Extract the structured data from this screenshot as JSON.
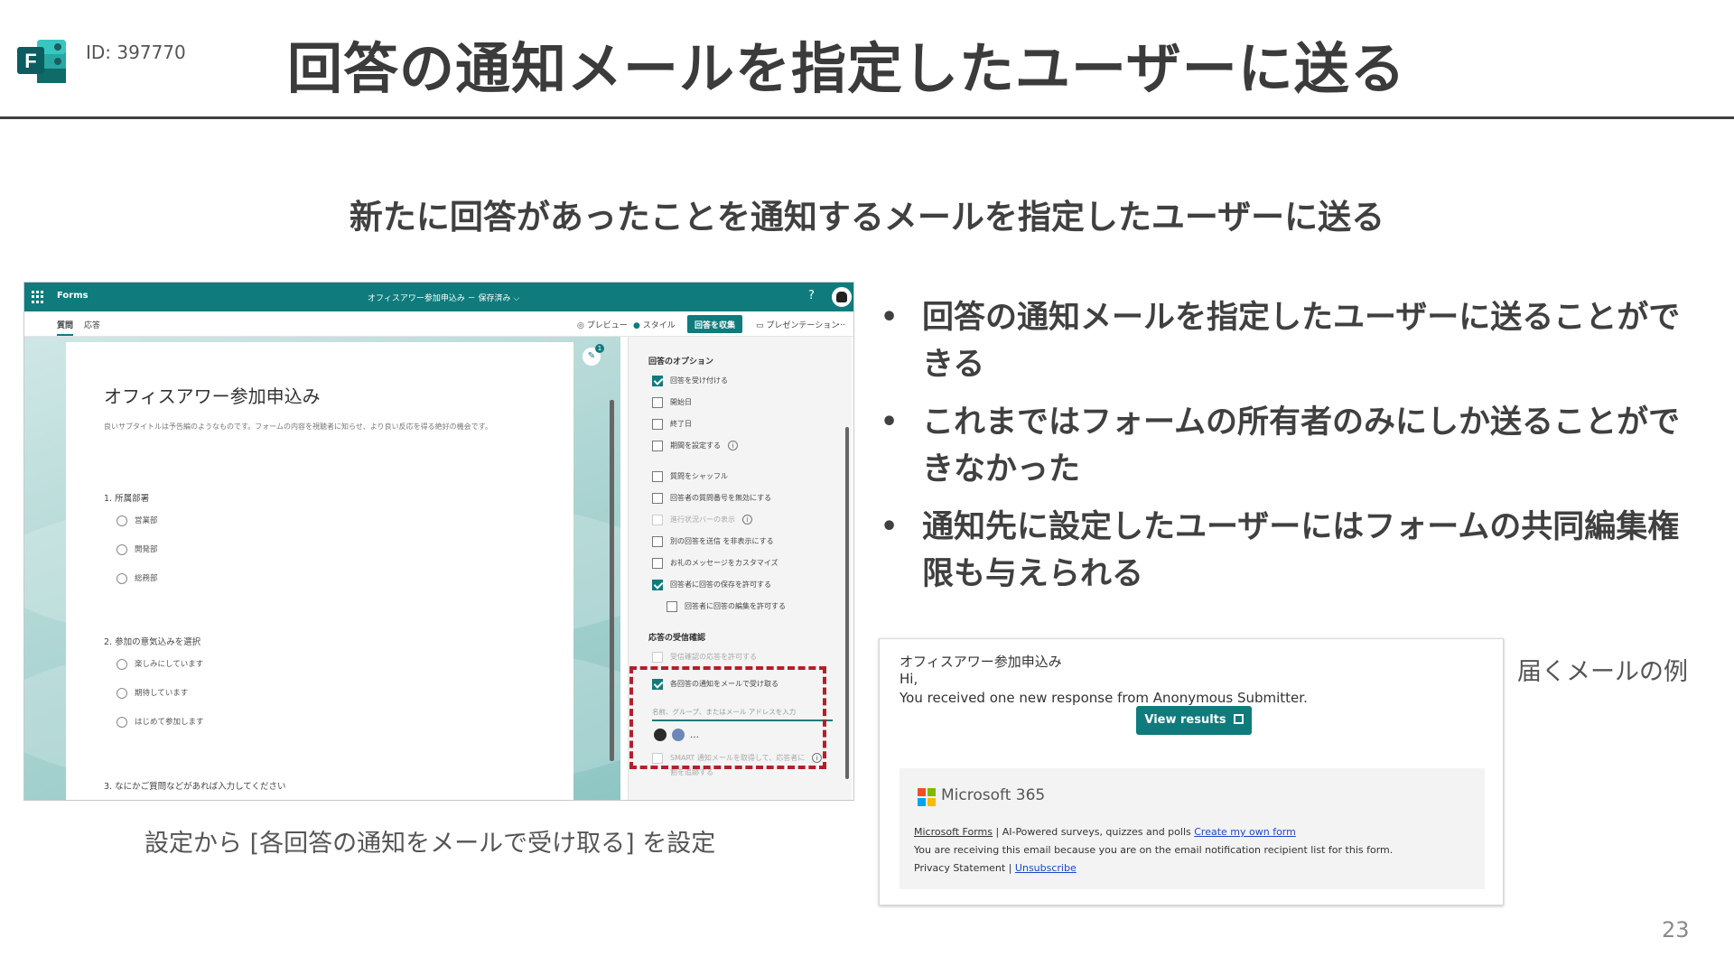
{
  "header": {
    "id_label": "ID: 397770",
    "title": "回答の通知メールを指定したユーザーに送る",
    "logo_icon": "microsoft-forms-icon",
    "logo_color": "#0f7b7c"
  },
  "subtitle": "新たに回答があったことを通知するメールを指定したユーザーに送る",
  "forms_screenshot": {
    "app_name": "Forms",
    "doc_title": "オフィスアワー参加申込み － 保存済み ⌵",
    "help": "?",
    "tabs": [
      "質問",
      "応答"
    ],
    "actions": {
      "preview": "プレビュー",
      "style": "スタイル",
      "collect": "回答を収集",
      "present": "プレゼンテーション",
      "more": "…"
    },
    "form": {
      "title": "オフィスアワー参加申込み",
      "description": "良いサブタイトルは予告編のようなものです。フォームの内容を視聴者に知らせ、より良い反応を得る絶好の機会です。",
      "questions": [
        {
          "title": "1. 所属部署",
          "options": [
            "営業部",
            "開発部",
            "総務部"
          ]
        },
        {
          "title": "2. 参加の意気込みを選択",
          "options": [
            "楽しみにしています",
            "期待しています",
            "はじめて参加します"
          ]
        },
        {
          "title": "3. なにかご質問などがあれば入力してください",
          "options": []
        }
      ],
      "badge": "1"
    },
    "settings": {
      "section_response": "回答のオプション",
      "options": [
        {
          "label": "回答を受け付ける",
          "checked": true
        },
        {
          "label": "開始日",
          "checked": false
        },
        {
          "label": "終了日",
          "checked": false
        },
        {
          "label": "期間を設定する",
          "checked": false,
          "info": true
        },
        {
          "label": "質問をシャッフル",
          "checked": false
        },
        {
          "label": "回答者の質問番号を無効にする",
          "checked": false
        },
        {
          "label": "進行状況バーの表示",
          "checked": false,
          "info": true,
          "faded": true
        },
        {
          "label": "別の回答を送信 を非表示にする",
          "checked": false
        },
        {
          "label": "お礼のメッセージをカスタマイズ",
          "checked": false
        },
        {
          "label": "回答者に回答の保存を許可する",
          "checked": true
        },
        {
          "label": "回答者に回答の編集を許可する",
          "checked": false,
          "indent": true
        }
      ],
      "section_receipt": "応答の受信確認",
      "receipt_faded": "受信確認の応答を許可する",
      "notify_label": "各回答の通知をメールで受け取る",
      "notify_checked": true,
      "recipient_placeholder": "名前、グループ、またはメール アドレスを入力",
      "more": "…",
      "smart_label": "SMART 通知メールを取得して、応答者に",
      "smart_label2": "割を追跡する"
    },
    "highlight_color": "#b3202a"
  },
  "forms_caption": "設定から [各回答の通知をメールで受け取る] を設定",
  "bullets": [
    "回答の通知メールを指定したユーザーに送ることができる",
    "これまではフォームの所有者のみにしか送ることができなかった",
    "通知先に設定したユーザーにはフォームの共同編集権限も与えられる"
  ],
  "email": {
    "form_name": "オフィスアワー参加申込み",
    "greeting": "Hi,",
    "message": "You received one new response from Anonymous Submitter.",
    "button": "View results",
    "brand": "Microsoft 365",
    "footer_product": "Microsoft Forms",
    "footer_tagline": " | AI-Powered surveys, quizzes and polls ",
    "footer_link": "Create my own form",
    "footer_notice": "You are receiving this email because you are on the email notification recipient list for this form.",
    "privacy": "Privacy Statement",
    "separator": " | ",
    "unsubscribe": "Unsubscribe",
    "button_color": "#0f7b7c",
    "ms_colors": [
      "#f25022",
      "#7fba00",
      "#00a4ef",
      "#ffb900"
    ]
  },
  "email_caption": "届くメールの例",
  "page_number": "23"
}
